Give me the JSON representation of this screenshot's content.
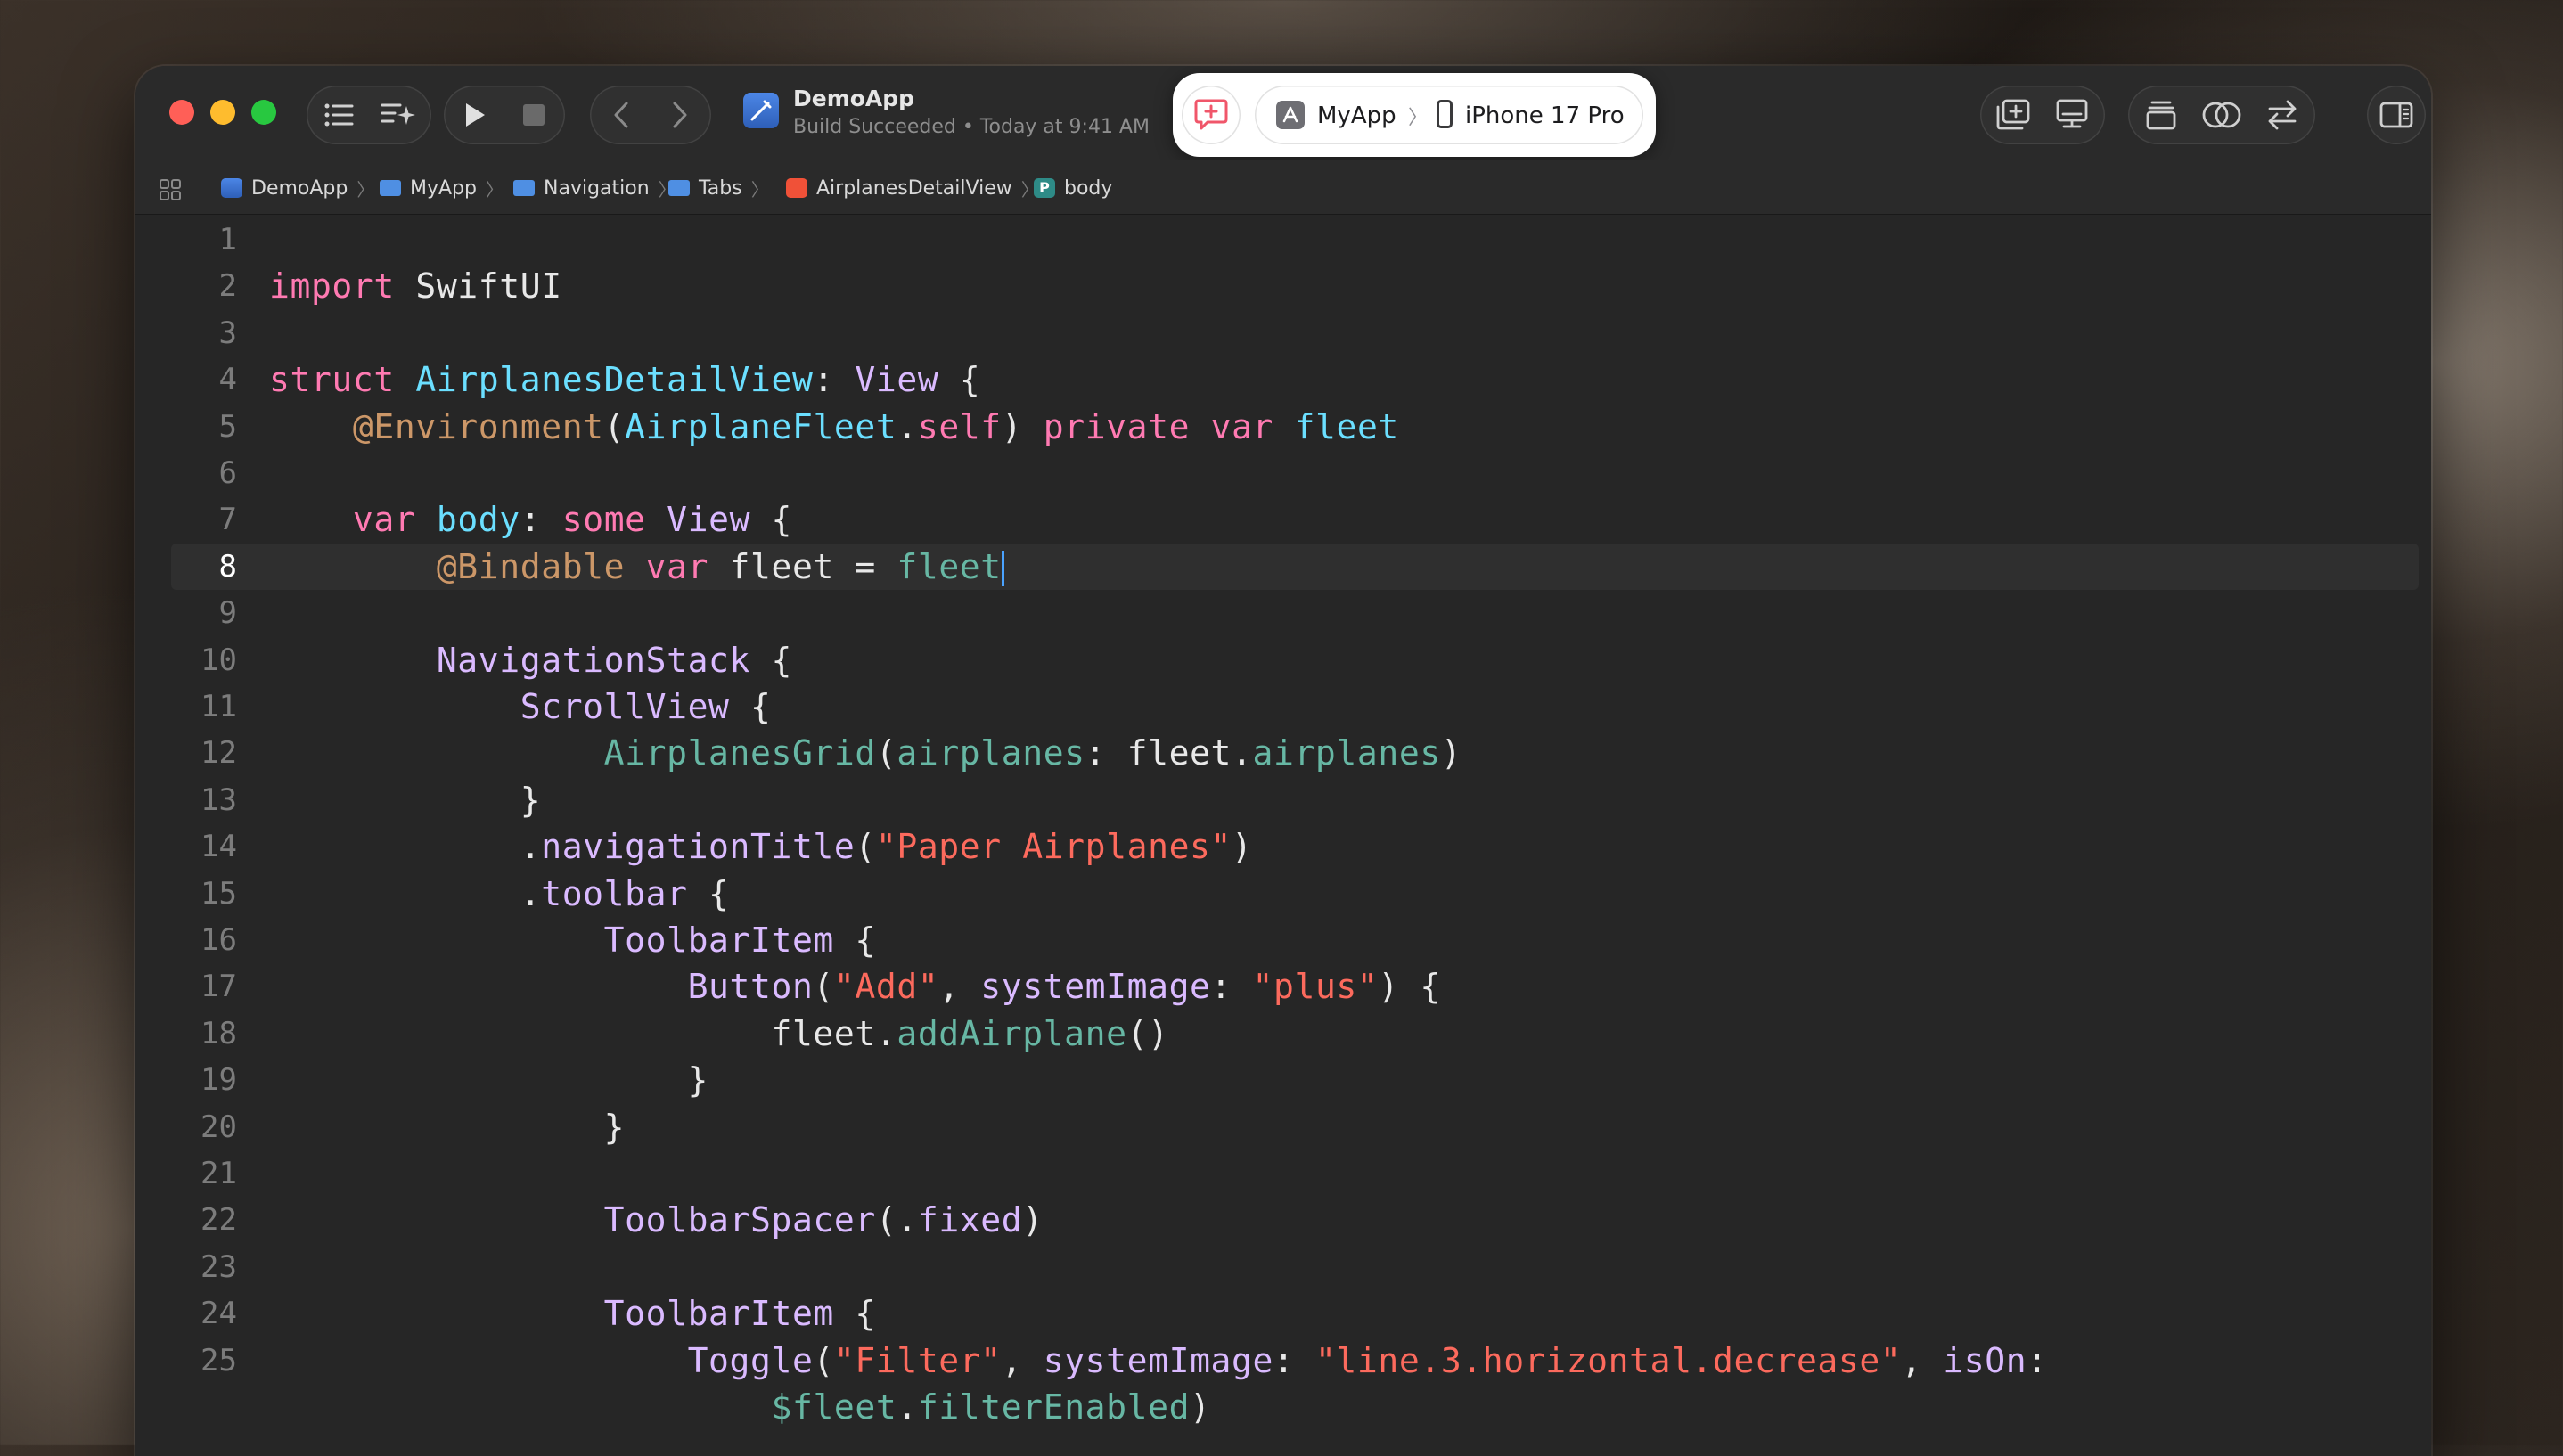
{
  "titlebar": {
    "project_name": "DemoApp",
    "build_status": "Build Succeeded • Today at 9:41 AM"
  },
  "scheme": {
    "app": "MyApp",
    "separator": "〉",
    "destination": "iPhone 17 Pro"
  },
  "jumpbar": {
    "items": [
      {
        "label": "DemoApp",
        "icon": "project-icon"
      },
      {
        "label": "MyApp",
        "icon": "folder-icon"
      },
      {
        "label": "Navigation",
        "icon": "folder-icon"
      },
      {
        "label": "Tabs",
        "icon": "folder-icon"
      },
      {
        "label": "AirplanesDetailView",
        "icon": "swift-file-icon"
      },
      {
        "label": "body",
        "icon": "property-icon"
      }
    ],
    "separator": "〉",
    "property_glyph": "P"
  },
  "editor": {
    "current_line": 8,
    "colors": {
      "keyword": "#ff7ab2",
      "type": "#dabaff",
      "project_type": "#6bdfff",
      "func": "#67b7a4",
      "string": "#fc6a5d",
      "attribute": "#cc9768",
      "plain": "#e8e8e8",
      "number": "#7c7c7c"
    },
    "lines": [
      {
        "n": "1",
        "tokens": []
      },
      {
        "n": "2",
        "tokens": [
          [
            "kw",
            "import"
          ],
          [
            "p",
            " SwiftUI"
          ]
        ]
      },
      {
        "n": "3",
        "tokens": []
      },
      {
        "n": "4",
        "tokens": [
          [
            "kw",
            "struct"
          ],
          [
            "p",
            " "
          ],
          [
            "pt",
            "AirplanesDetailView"
          ],
          [
            "p",
            ": "
          ],
          [
            "ty",
            "View"
          ],
          [
            "p",
            " {"
          ]
        ]
      },
      {
        "n": "5",
        "tokens": [
          [
            "p",
            "    "
          ],
          [
            "at",
            "@Environment"
          ],
          [
            "p",
            "("
          ],
          [
            "pt",
            "AirplaneFleet"
          ],
          [
            "p",
            "."
          ],
          [
            "kw",
            "self"
          ],
          [
            "p",
            ") "
          ],
          [
            "kw",
            "private"
          ],
          [
            "p",
            " "
          ],
          [
            "kw",
            "var"
          ],
          [
            "p",
            " "
          ],
          [
            "pt",
            "fleet"
          ]
        ]
      },
      {
        "n": "6",
        "tokens": []
      },
      {
        "n": "7",
        "tokens": [
          [
            "p",
            "    "
          ],
          [
            "kw",
            "var"
          ],
          [
            "p",
            " "
          ],
          [
            "pt",
            "body"
          ],
          [
            "p",
            ": "
          ],
          [
            "kw",
            "some"
          ],
          [
            "p",
            " "
          ],
          [
            "ty",
            "View"
          ],
          [
            "p",
            " {"
          ]
        ]
      },
      {
        "n": "8",
        "tokens": [
          [
            "p",
            "        "
          ],
          [
            "at",
            "@Bindable"
          ],
          [
            "p",
            " "
          ],
          [
            "kw",
            "var"
          ],
          [
            "p",
            " fleet = "
          ],
          [
            "fn",
            "fleet"
          ]
        ]
      },
      {
        "n": "9",
        "tokens": []
      },
      {
        "n": "10",
        "tokens": [
          [
            "p",
            "        "
          ],
          [
            "ty",
            "NavigationStack"
          ],
          [
            "p",
            " {"
          ]
        ]
      },
      {
        "n": "11",
        "tokens": [
          [
            "p",
            "            "
          ],
          [
            "ty",
            "ScrollView"
          ],
          [
            "p",
            " {"
          ]
        ]
      },
      {
        "n": "12",
        "tokens": [
          [
            "p",
            "                "
          ],
          [
            "fn",
            "AirplanesGrid"
          ],
          [
            "p",
            "("
          ],
          [
            "fn",
            "airplanes"
          ],
          [
            "p",
            ": fleet."
          ],
          [
            "fn",
            "airplanes"
          ],
          [
            "p",
            ")"
          ]
        ]
      },
      {
        "n": "13",
        "tokens": [
          [
            "p",
            "            }"
          ]
        ]
      },
      {
        "n": "14",
        "tokens": [
          [
            "p",
            "            ."
          ],
          [
            "ty",
            "navigationTitle"
          ],
          [
            "p",
            "("
          ],
          [
            "st",
            "\"Paper Airplanes\""
          ],
          [
            "p",
            ")"
          ]
        ]
      },
      {
        "n": "15",
        "tokens": [
          [
            "p",
            "            ."
          ],
          [
            "ty",
            "toolbar"
          ],
          [
            "p",
            " {"
          ]
        ]
      },
      {
        "n": "16",
        "tokens": [
          [
            "p",
            "                "
          ],
          [
            "ty",
            "ToolbarItem"
          ],
          [
            "p",
            " {"
          ]
        ]
      },
      {
        "n": "17",
        "tokens": [
          [
            "p",
            "                    "
          ],
          [
            "ty",
            "Button"
          ],
          [
            "p",
            "("
          ],
          [
            "st",
            "\"Add\""
          ],
          [
            "p",
            ", "
          ],
          [
            "ty",
            "systemImage"
          ],
          [
            "p",
            ": "
          ],
          [
            "st",
            "\"plus\""
          ],
          [
            "p",
            ") {"
          ]
        ]
      },
      {
        "n": "18",
        "tokens": [
          [
            "p",
            "                        fleet."
          ],
          [
            "fn",
            "addAirplane"
          ],
          [
            "p",
            "()"
          ]
        ]
      },
      {
        "n": "19",
        "tokens": [
          [
            "p",
            "                    }"
          ]
        ]
      },
      {
        "n": "20",
        "tokens": [
          [
            "p",
            "                }"
          ]
        ]
      },
      {
        "n": "21",
        "tokens": []
      },
      {
        "n": "22",
        "tokens": [
          [
            "p",
            "                "
          ],
          [
            "ty",
            "ToolbarSpacer"
          ],
          [
            "p",
            "(."
          ],
          [
            "ty",
            "fixed"
          ],
          [
            "p",
            ")"
          ]
        ]
      },
      {
        "n": "23",
        "tokens": []
      },
      {
        "n": "24",
        "tokens": [
          [
            "p",
            "                "
          ],
          [
            "ty",
            "ToolbarItem"
          ],
          [
            "p",
            " {"
          ]
        ]
      },
      {
        "n": "25",
        "tokens": [
          [
            "p",
            "                    "
          ],
          [
            "ty",
            "Toggle"
          ],
          [
            "p",
            "("
          ],
          [
            "st",
            "\"Filter\""
          ],
          [
            "p",
            ", "
          ],
          [
            "ty",
            "systemImage"
          ],
          [
            "p",
            ": "
          ],
          [
            "st",
            "\"line.3.horizontal.decrease\""
          ],
          [
            "p",
            ", "
          ],
          [
            "ty",
            "isOn"
          ],
          [
            "p",
            ":"
          ]
        ]
      },
      {
        "n": "",
        "tokens": [
          [
            "p",
            "                        "
          ],
          [
            "fn",
            "$fleet"
          ],
          [
            "p",
            "."
          ],
          [
            "fn",
            "filterEnabled"
          ],
          [
            "p",
            ")"
          ]
        ]
      }
    ]
  }
}
